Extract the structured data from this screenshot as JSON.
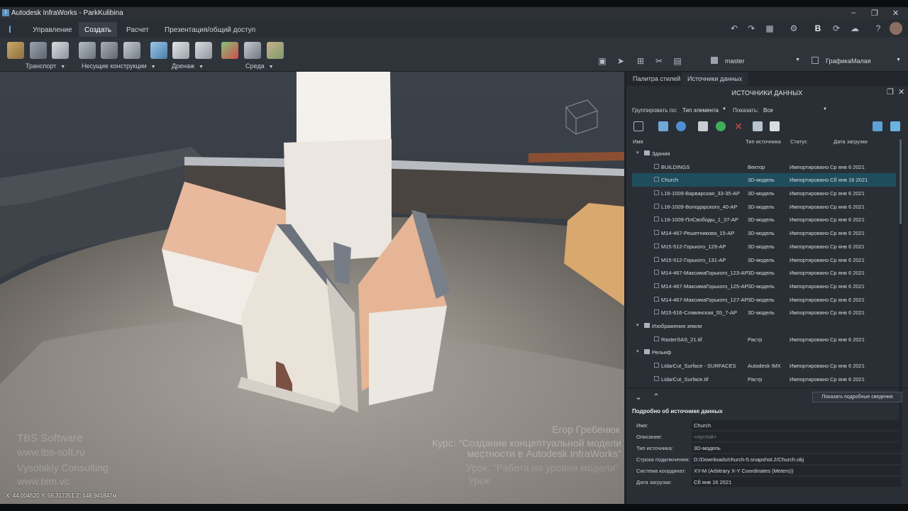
{
  "window": {
    "title": "Autodesk InfraWorks - ParkKulibina",
    "app_icon": "I"
  },
  "ribbon_tabs": [
    "Управление",
    "Создать",
    "Расчет",
    "Презентация/общий доступ"
  ],
  "active_tab": "Создать",
  "ribbon_groups": [
    "Транспорт",
    "Несущие конструкции",
    "Дренаж",
    "Среда"
  ],
  "right_toolbar": {
    "branch": "master",
    "graphics": "ГрафикаМалая"
  },
  "panel": {
    "tabs": [
      "Палитра стилей",
      "Источники данных"
    ],
    "active_tab": "Источники данных",
    "title": "ИСТОЧНИКИ ДАННЫХ",
    "group_by_label": "Группировать по:",
    "group_by_value": "Тип элемента",
    "show_label": "Показать:",
    "show_value": "Все",
    "columns": [
      "Имя",
      "Тип источника",
      "Статус",
      "Дата загрузки"
    ],
    "rows": [
      {
        "kind": "group",
        "name": "Здания"
      },
      {
        "kind": "item",
        "name": "BUILDINGS",
        "type": "Вектор",
        "status": "Импортировано",
        "date": "Ср янв 6 2021"
      },
      {
        "kind": "item",
        "name": "Church",
        "type": "3D-модель",
        "status": "Импортировано",
        "date": "Сб янв 16 2021",
        "selected": true
      },
      {
        "kind": "item",
        "name": "L16-1009-Варварская_33-35-АР",
        "type": "3D-модель",
        "status": "Импортировано",
        "date": "Ср янв 6 2021"
      },
      {
        "kind": "item",
        "name": "L16-1009-Володарского_40-АР",
        "type": "3D-модель",
        "status": "Импортировано",
        "date": "Ср янв 6 2021"
      },
      {
        "kind": "item",
        "name": "L16-1009-ПлСвободы_1_37-АР",
        "type": "3D-модель",
        "status": "Импортировано",
        "date": "Ср янв 6 2021"
      },
      {
        "kind": "item",
        "name": "M14-467-Решетникова_15-АР",
        "type": "3D-модель",
        "status": "Импортировано",
        "date": "Ср янв 6 2021"
      },
      {
        "kind": "item",
        "name": "M15-512-Горького_129-АР",
        "type": "3D-модель",
        "status": "Импортировано",
        "date": "Ср янв 6 2021"
      },
      {
        "kind": "item",
        "name": "M15-512-Горького_131-АР",
        "type": "3D-модель",
        "status": "Импортировано",
        "date": "Ср янв 6 2021"
      },
      {
        "kind": "item",
        "name": "M14-467-МаксимаГорького_123-АР",
        "type": "3D-модель",
        "status": "Импортировано",
        "date": "Ср янв 6 2021"
      },
      {
        "kind": "item",
        "name": "M14-467-МаксимаГорького_125-АР",
        "type": "3D-модель",
        "status": "Импортировано",
        "date": "Ср янв 6 2021"
      },
      {
        "kind": "item",
        "name": "M14-467-МаксимаГорького_127-АР",
        "type": "3D-модель",
        "status": "Импортировано",
        "date": "Ср янв 6 2021"
      },
      {
        "kind": "item",
        "name": "M15-616-Славянская_55_7-АР",
        "type": "3D-модель",
        "status": "Импортировано",
        "date": "Ср янв 6 2021"
      },
      {
        "kind": "group",
        "name": "Изображения земли"
      },
      {
        "kind": "item",
        "name": "RasterSAS_21.tif",
        "type": "Растр",
        "status": "Импортировано",
        "date": "Ср янв 6 2021"
      },
      {
        "kind": "group",
        "name": "Рельеф"
      },
      {
        "kind": "item",
        "name": "LidarCut_Surface - SURFACES",
        "type": "Autodesk IMX",
        "status": "Импортировано",
        "date": "Ср янв 6 2021"
      },
      {
        "kind": "item",
        "name": "LidarCut_Surface.tif",
        "type": "Растр",
        "status": "Импортировано",
        "date": "Ср янв 6 2021"
      }
    ],
    "details_button": "Показать подробные сведения",
    "details_title": "Подробно об источнике данных",
    "details": [
      {
        "key": "Имя:",
        "value": "Church"
      },
      {
        "key": "Описание:",
        "value": "<пустой>",
        "placeholder": true
      },
      {
        "key": "Тип источника:",
        "value": "3D-модель"
      },
      {
        "key": "Строка подключения:",
        "value": "D:/Downloads/church-5.snapshot.2/Church.obj"
      },
      {
        "key": "Система координат:",
        "value": "XY-M (Arbitrary X-Y Coordinates (Meters))"
      },
      {
        "key": "Дата загрузки:",
        "value": "Сб янв 16 2021"
      }
    ]
  },
  "viewport": {
    "coords": "X: 44.004520 Y: 56.317351 Z: 148.941847м",
    "watermark_left": [
      "TBS Software",
      "www.tbs-soft.ru",
      "Vysotskiy Consulting",
      "www.bim.vc"
    ],
    "watermark_right": [
      "Егор Гребенюк",
      "Курс: \"Создание концептуальной модели",
      "местности в Autodesk InfraWorks\"",
      "Урок: \"Работа на уровне модели\"",
      "Урок"
    ]
  }
}
